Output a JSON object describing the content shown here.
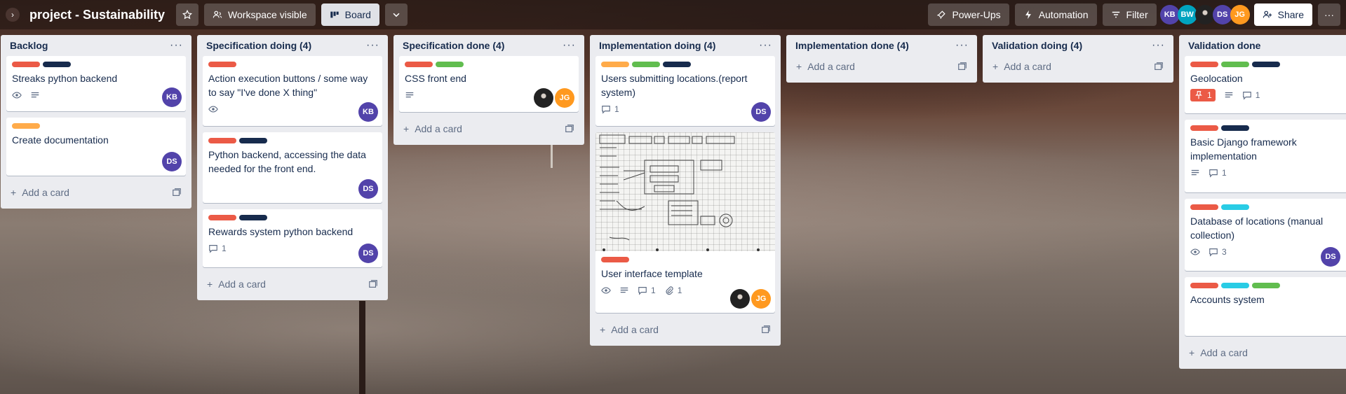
{
  "header": {
    "title": "project - Sustainability",
    "visibility_label": "Workspace visible",
    "view_label": "Board",
    "powerups_label": "Power-Ups",
    "automation_label": "Automation",
    "filter_label": "Filter",
    "share_label": "Share",
    "members": [
      {
        "initials": "KB",
        "color": "#5243aa"
      },
      {
        "initials": "BW",
        "color": "#00a3bf"
      },
      {
        "initials": "",
        "color": "#2a2a2a"
      },
      {
        "initials": "DS",
        "color": "#5243aa"
      },
      {
        "initials": "JG",
        "color": "#ff991f"
      }
    ]
  },
  "colors": {
    "red": "#eb5a46",
    "navy": "#172b4d",
    "orange": "#ffab4a",
    "green": "#61bd4f",
    "sky": "#29cce5",
    "member_kb": "#5243aa",
    "member_ds": "#5243aa",
    "member_jg": "#ff991f"
  },
  "add_card_label": "Add a card",
  "lists": [
    {
      "title": "Backlog",
      "cards": [
        {
          "title": "Streaks python backend"
        },
        {
          "title": "Create documentation"
        }
      ]
    },
    {
      "title": "Specification doing (4)",
      "cards": [
        {
          "title": "Action execution buttons / some way to say \"I've done X thing\""
        },
        {
          "title": "Python backend, accessing the data needed for the front end."
        },
        {
          "title": "Rewards system python backend",
          "comments": "1"
        }
      ]
    },
    {
      "title": "Specification done (4)",
      "cards": [
        {
          "title": "CSS front end"
        }
      ]
    },
    {
      "title": "Implementation doing (4)",
      "cards": [
        {
          "title": "Users submitting locations.(report system)",
          "comments": "1"
        },
        {
          "title": "User interface template",
          "comments": "1",
          "attachments": "1"
        }
      ]
    },
    {
      "title": "Implementation done (4)",
      "cards": []
    },
    {
      "title": "Validation doing (4)",
      "cards": []
    },
    {
      "title": "Validation done",
      "cards": [
        {
          "title": "Geolocation",
          "red_badge": "1",
          "comments": "1"
        },
        {
          "title": "Basic Django framework implementation",
          "comments": "1"
        },
        {
          "title": "Database of locations (manual collection)",
          "comments": "3"
        },
        {
          "title": "Accounts system"
        }
      ]
    }
  ],
  "member_initials": {
    "kb": "KB",
    "ds": "DS",
    "jg": "JG"
  },
  "icons": [
    "chevron-right-icon",
    "star-icon",
    "people-icon",
    "board-icon",
    "chevron-down-icon",
    "rocket-icon",
    "bolt-icon",
    "filter-icon",
    "share-icon",
    "eye-icon",
    "description-icon",
    "comment-icon",
    "attachment-icon",
    "card-template-icon",
    "plus-icon"
  ]
}
